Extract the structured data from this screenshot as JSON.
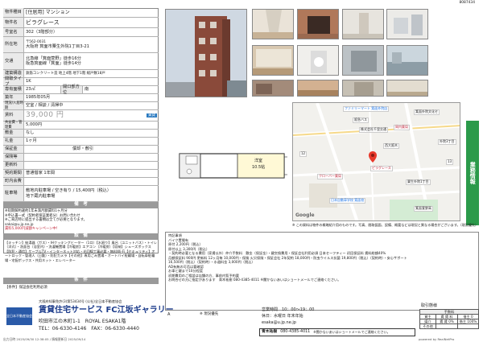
{
  "doc_id": "8087434",
  "rows": {
    "type": {
      "label": "物件種目",
      "value": "[住居用] マンション"
    },
    "name": {
      "label": "物件名",
      "value": "ビラグレース"
    },
    "room": {
      "label": "号室名",
      "value": "302（3階部分）"
    },
    "address": {
      "label": "所在地",
      "zip": "〒562-0031",
      "value": "大阪府 箕面市粟生外院1丁目3-21"
    },
    "traffic": {
      "label": "交通",
      "line1": "北急線「箕面萱野」徒歩16分",
      "line2": "阪急箕面線「箕面」徒歩14分"
    },
    "structure": {
      "label": "建築構造",
      "value": "鉄筋コンクリート造 地上4階 地下1階 総戸数18戸"
    },
    "move_in": {
      "label": "間取タイプ",
      "value": "1K"
    },
    "area": {
      "label": "専有面積",
      "value": "23㎡",
      "dir_label": "開口部方位",
      "dir_value": "南"
    },
    "built": {
      "label": "築年",
      "value": "1985年05月"
    },
    "status": {
      "label": "現況/入居時期",
      "value": "空室 / 相談 / 清掃中"
    },
    "rent": {
      "label": "賃料",
      "value": "39,000 円",
      "badge": "賃貸"
    },
    "fee": {
      "label": "共益費・管理費",
      "value": "5,000円"
    },
    "deposit": {
      "label": "敷金",
      "value": "なし"
    },
    "key": {
      "label": "礼金",
      "value": "1ヶ月"
    },
    "guarantee": {
      "label": "保証金",
      "value": "",
      "extra": "償却・敷引"
    },
    "insurance": {
      "label": "保険等",
      "value": ""
    },
    "renewal": {
      "label": "更新料",
      "value": ""
    },
    "contract": {
      "label": "契約期間",
      "value": "普通借家 1年間"
    },
    "community": {
      "label": "町内会費",
      "value": ""
    },
    "parking": {
      "label": "駐車場",
      "value": "敷地内駐車場 / 空き有り / 15,400円（税込）",
      "value2": "地下蔵内駐車場"
    }
  },
  "remarks_header": "備　考",
  "remarks": [
    "※短期解約違約1年未満月額賃料1ヶ月分",
    "※申込書一式（契約者保証業者分）お問い合わせ",
    "※ご来店時に提出する書類は全てが必要となります。",
    "sakai@u.jp.ne.jp",
    "賃料5,000円減額キャンペーン中！"
  ],
  "features_header": "設　備",
  "features": "【キッチン】給湯器（ガス）・IHクッキングヒーター（1口）【水廻り】風呂（ユニットバス）・トイレ（洋式）・洗面台（浴室内）・洗濯機置場【冷暖房】エアコン（冷暖房）【収納】シューズボックス【防犯・通信】ケーブルTV・インターネット対応・光回線工事必要・無料Wi-Fi【セキュリティ】オートロック・管理人（日勤）・防犯カメラ【その他】専用ごみ置場・オートバイ駐輪場・自転車駐輪場・宅配ボックス・共用ネット・エレベーター",
  "conditions_header": "条　件",
  "conditions": "【条件】保証会社利用必須",
  "floor_label": "洋室",
  "floor_size": "10.5帖",
  "floor_a": "A",
  "floor_note": "※ 現況優先",
  "map": {
    "labels": [
      "ファミリーマート 箕面外院店",
      "阪急バス",
      "箕面外院文化セ",
      "株式会社千里交通",
      "岡内薬局",
      "外院3丁目",
      "クローバー薬局",
      "日本自動車学校 箕面校",
      "西大阪木",
      "ピラグレース",
      "12",
      "粟生外院1丁目",
      "箕面萱野高",
      "13"
    ],
    "google": "Google"
  },
  "map_note": "※ この資料は物件の概略紹介用のものです。写真、間取図面、設備、概要などは現況と異なる場合がございます。（現況優先）",
  "extra_header": "特記事項",
  "extra_lines": [
    "バイク置場有",
    "原付 2,200円（税込）",
    "原付以上 3,300円（税込）",
    "・契約時必要となる費用（家賃以外）仲介手数料　敷金（保証金）・鍵交換費用・保証会社利用必須 日本セーフティー 初回保証料 賃料総額40%",
    "月額保証料 900円 更新料 12ヶ月毎 10,000円・保険 火災保険・保証会社 2年契約 18,000円・防虫ウイルス抗菌 19,800円（税込）（契約時）・安心サポート",
    "16,500円（税込）（契約時）・水道料金 3,000円（税込）",
    "AD有無の可否は要確認",
    "お車と鍵まで10分程度",
    "初期費用のご相談は店舗の方、事前内覧予約要",
    "お問合せの方に指定があります　青木祐樹 080-4385-4011 ※聞かないあいはショートメールでご連絡ください。"
  ],
  "footer": {
    "license": "大阪府知事免許(3)第53434号 (公社)全日本不動産協会",
    "company_sub": "全日本不動産協会",
    "company": "賃貸住宅サービス FC江坂ギャラリー",
    "address": "吹田市江の木町1-1　ROYAL ESAKA1階",
    "tel": "TEL：06-6330-4146　FAX：06-6330-4440",
    "hours_label": "営業時間",
    "hours": "10：00～19：00",
    "holiday": "休日：水曜日 年末年始",
    "email": "esaka@u.jp.ne.jp",
    "contact_name": "青木祐樹",
    "contact_tel": "080-4385-4011",
    "contact_note": "※聞かないあいはショートメールでご連絡ください。"
  },
  "terms": {
    "title": "取引態様",
    "col": "手数料",
    "rows": [
      [
        "貸主",
        "賃 賃 料",
        "借主 0"
      ],
      [
        "媒介",
        "賃 賃 0%",
        "借主 100%"
      ],
      [
        "その他",
        "",
        ""
      ]
    ]
  },
  "side_label": "業務情報",
  "print_line": "出力日時 2025/09/30 12:38:05 / 情報更新日 2025/09/14",
  "print_right": "powered by RealNetPro",
  "page": "1 / 1"
}
